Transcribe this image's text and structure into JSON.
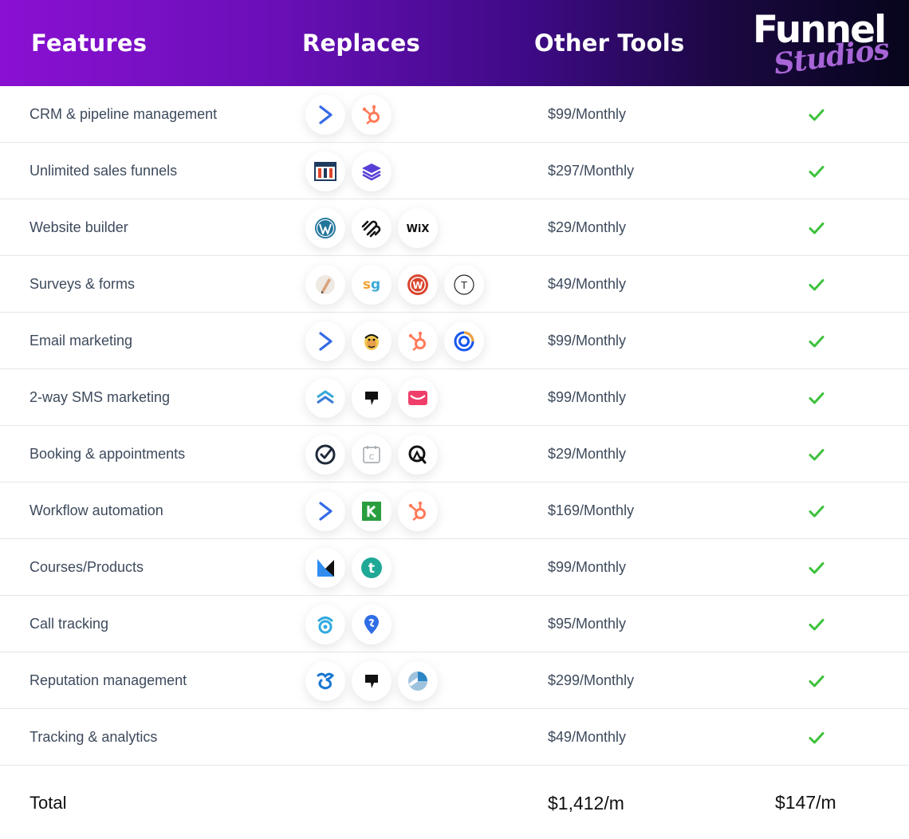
{
  "header": {
    "features": "Features",
    "replaces": "Replaces",
    "other_tools": "Other Tools",
    "logo_line1": "Funnel",
    "logo_line2": "Studios"
  },
  "colors": {
    "check": "#3cc13b",
    "header_start": "#8a10d2",
    "header_end": "#07051c"
  },
  "rows": [
    {
      "feature": "CRM & pipeline management",
      "price": "$99/Monthly",
      "icons": [
        "activecampaign-icon",
        "hubspot-icon"
      ]
    },
    {
      "feature": "Unlimited sales funnels",
      "price": "$297/Monthly",
      "icons": [
        "clickfunnels-icon",
        "stack-layers-icon"
      ]
    },
    {
      "feature": "Website builder",
      "price": "$29/Monthly",
      "icons": [
        "wordpress-icon",
        "squarespace-icon",
        "wix-icon"
      ]
    },
    {
      "feature": "Surveys & forms",
      "price": "$49/Monthly",
      "icons": [
        "jotform-pen-icon",
        "surveygizmo-icon",
        "wufoo-icon",
        "typeform-icon"
      ]
    },
    {
      "feature": "Email marketing",
      "price": "$99/Monthly",
      "icons": [
        "activecampaign-icon",
        "mailchimp-icon",
        "hubspot-icon",
        "constant-contact-icon"
      ]
    },
    {
      "feature": "2-way SMS marketing",
      "price": "$99/Monthly",
      "icons": [
        "chevrons-up-icon",
        "speech-flag-icon",
        "envelope-icon"
      ]
    },
    {
      "feature": "Booking & appointments",
      "price": "$29/Monthly",
      "icons": [
        "acuity-check-icon",
        "calendly-icon",
        "q-target-icon"
      ]
    },
    {
      "feature": "Workflow automation",
      "price": "$169/Monthly",
      "icons": [
        "activecampaign-icon",
        "keap-icon",
        "hubspot-icon"
      ]
    },
    {
      "feature": "Courses/Products",
      "price": "$99/Monthly",
      "icons": [
        "kajabi-icon",
        "teachable-icon"
      ]
    },
    {
      "feature": "Call tracking",
      "price": "$95/Monthly",
      "icons": [
        "callrail-icon",
        "location-pin-icon"
      ]
    },
    {
      "feature": "Reputation management",
      "price": "$299/Monthly",
      "icons": [
        "birdeye-icon",
        "speech-flag-icon",
        "sprout-icon"
      ]
    },
    {
      "feature": "Tracking & analytics",
      "price": "$49/Monthly",
      "icons": []
    }
  ],
  "total": {
    "label": "Total",
    "other": "$1,412/m",
    "funnel": "$147/m"
  }
}
